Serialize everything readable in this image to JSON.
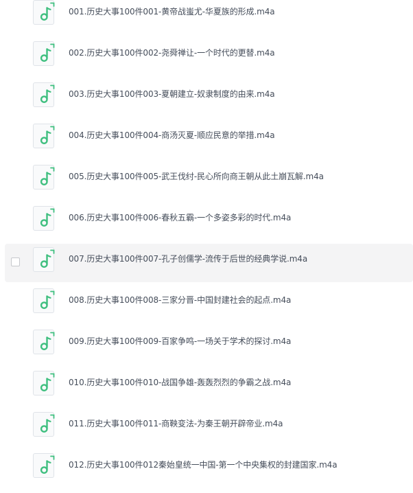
{
  "files": [
    {
      "name": "001.历史大事100件001-黄帝战蚩尤-华夏族的形成.m4a",
      "icon": "audio-file-icon"
    },
    {
      "name": "002.历史大事100件002-尧舜禅让-一个时代的更替.m4a",
      "icon": "audio-file-icon"
    },
    {
      "name": "003.历史大事100件003-夏朝建立-奴隶制度的由来.m4a",
      "icon": "audio-file-icon"
    },
    {
      "name": "004.历史大事100件004-商汤灭夏-顺应民意的举措.m4a",
      "icon": "audio-file-icon"
    },
    {
      "name": "005.历史大事100件005-武王伐纣-民心所向商王朝从此土崩瓦解.m4a",
      "icon": "audio-file-icon"
    },
    {
      "name": "006.历史大事100件006-春秋五霸-一个多姿多彩的时代.m4a",
      "icon": "audio-file-icon"
    },
    {
      "name": "007.历史大事100件007-孔子创儒学-流传于后世的经典学说.m4a",
      "icon": "audio-file-icon",
      "hovered": true
    },
    {
      "name": "008.历史大事100件008-三家分晋-中国封建社会的起点.m4a",
      "icon": "audio-file-icon"
    },
    {
      "name": "009.历史大事100件009-百家争鸣-一场关于学术的探讨.m4a",
      "icon": "audio-file-icon"
    },
    {
      "name": "010.历史大事100件010-战国争雄-轰轰烈烈的争霸之战.m4a",
      "icon": "audio-file-icon"
    },
    {
      "name": "011.历史大事100件011-商鞅变法-为秦王朝开辟帝业.m4a",
      "icon": "audio-file-icon"
    },
    {
      "name": "012.历史大事100件012秦始皇统一中国-第一个中央集权的封建国家.m4a",
      "icon": "audio-file-icon"
    }
  ],
  "colors": {
    "icon_accent": "#3fbf7f",
    "text": "#454d5a",
    "hover_background": "#f4f4f5"
  }
}
